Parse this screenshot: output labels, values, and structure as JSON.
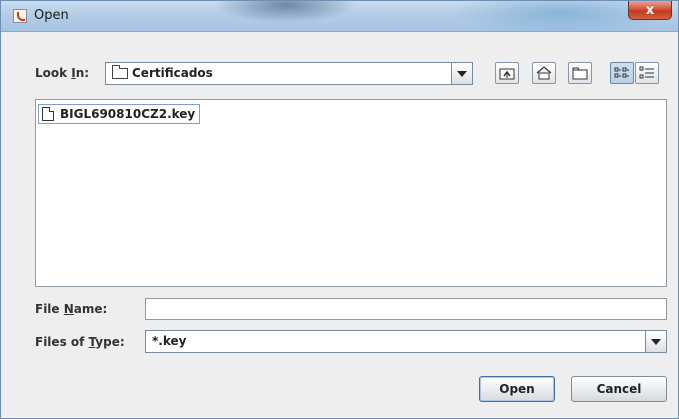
{
  "window": {
    "title": "Open",
    "close_label": "x"
  },
  "look_in": {
    "label_pre": "Look ",
    "label_mnemonic": "I",
    "label_post": "n:",
    "value": "Certificados"
  },
  "toolbar": {
    "icons": [
      "up-one-level-icon",
      "home-icon",
      "new-folder-icon",
      "list-view-icon",
      "details-view-icon"
    ],
    "selected_view": "list"
  },
  "files": [
    {
      "name": "BIGL690810CZ2.key",
      "icon": "file-icon"
    }
  ],
  "file_name": {
    "label_pre": "File ",
    "label_mnemonic": "N",
    "label_post": "ame:",
    "value": ""
  },
  "file_type": {
    "label_pre": "Files of ",
    "label_mnemonic": "T",
    "label_post": "ype:",
    "value": "*.key"
  },
  "buttons": {
    "open": "Open",
    "cancel": "Cancel"
  },
  "colors": {
    "title_bar": "#b4cde6",
    "close": "#d8543a",
    "selection_border": "#7ba0c9"
  }
}
